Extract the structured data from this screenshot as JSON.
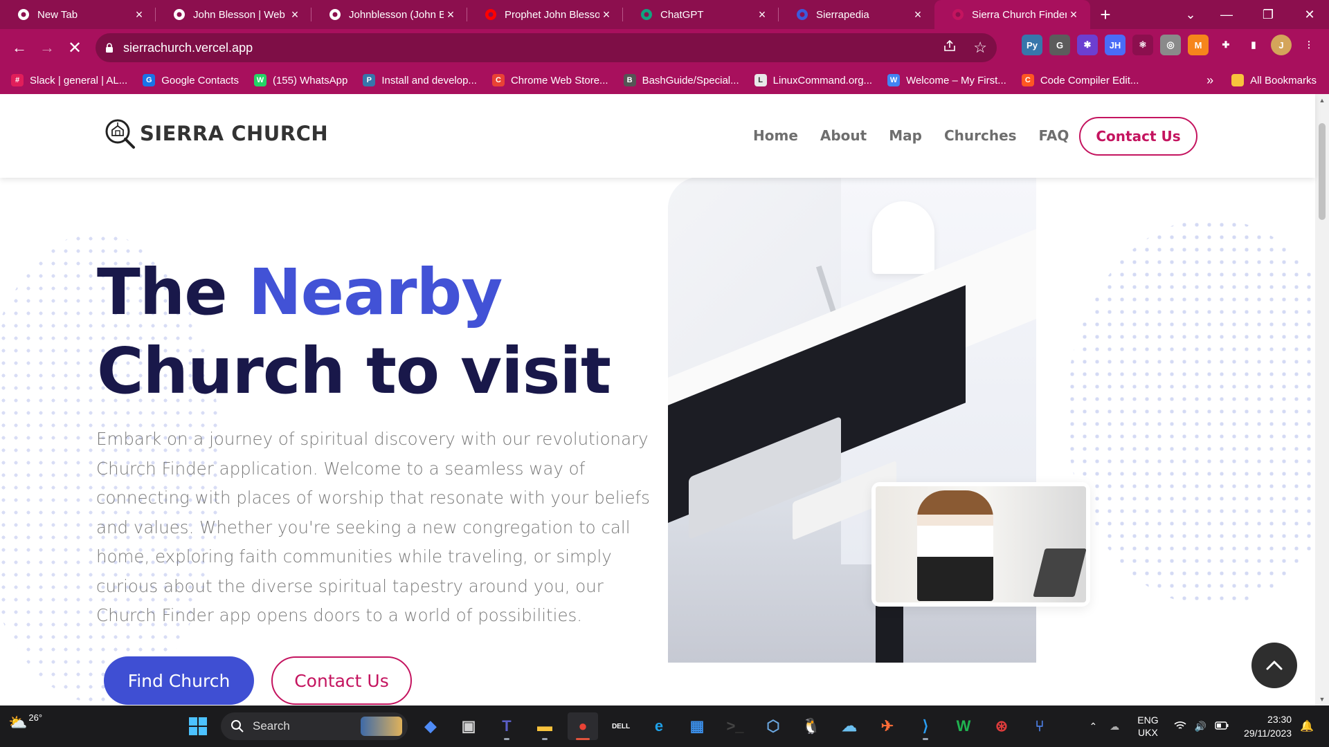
{
  "browser": {
    "tabs": [
      {
        "label": "New Tab",
        "icon": "chrome-icon",
        "color": "#ffffff"
      },
      {
        "label": "John Blesson | Web D",
        "icon": "globe-icon",
        "color": "#ffffff"
      },
      {
        "label": "Johnblesson (John Bl",
        "icon": "github-icon",
        "color": "#ffffff"
      },
      {
        "label": "Prophet John Blesson",
        "icon": "youtube-icon",
        "color": "#ff0000"
      },
      {
        "label": "ChatGPT",
        "icon": "chatgpt-icon",
        "color": "#10a37f"
      },
      {
        "label": "Sierrapedia",
        "icon": "sierrapedia-icon",
        "color": "#3b5bdb"
      },
      {
        "label": "Sierra Church Finder",
        "icon": "sierra-church-icon",
        "color": "#c4145f"
      }
    ],
    "active_tab_index": 6,
    "url": "sierrachurch.vercel.app",
    "bookmarks": [
      {
        "label": "Slack | general | AL...",
        "color": "#e01e5a",
        "glyph": "#"
      },
      {
        "label": "Google Contacts",
        "color": "#1a73e8",
        "glyph": "G"
      },
      {
        "label": "(155) WhatsApp",
        "color": "#25d366",
        "glyph": "W"
      },
      {
        "label": "Install and develop...",
        "color": "#3776ab",
        "glyph": "P"
      },
      {
        "label": "Chrome Web Store...",
        "color": "#e94235",
        "glyph": "C"
      },
      {
        "label": "BashGuide/Special...",
        "color": "#555555",
        "glyph": "B"
      },
      {
        "label": "LinuxCommand.org...",
        "color": "#e8e8e8",
        "glyph": "L"
      },
      {
        "label": "Welcome – My First...",
        "color": "#4285f4",
        "glyph": "W"
      },
      {
        "label": "Code Compiler Edit...",
        "color": "#ff5722",
        "glyph": "C"
      }
    ],
    "bookmarks_overflow": "»",
    "all_bookmarks": "All Bookmarks",
    "extensions": [
      {
        "name": "python-extension-icon",
        "color": "#3776ab",
        "glyph": "Py"
      },
      {
        "name": "grammarly-extension-icon",
        "color": "#5c5c5c",
        "glyph": "G"
      },
      {
        "name": "settings-extension-icon",
        "color": "#6c3fd1",
        "glyph": "✱"
      },
      {
        "name": "jh-extension-icon",
        "color": "#4a6cf7",
        "glyph": "JH"
      },
      {
        "name": "react-devtools-icon",
        "color": "#8c0f4e",
        "glyph": "⚛"
      },
      {
        "name": "web-extension-icon",
        "color": "#8a8a8a",
        "glyph": "◎"
      },
      {
        "name": "metamask-icon",
        "color": "#f6851b",
        "glyph": "M"
      },
      {
        "name": "extensions-puzzle-icon",
        "color": "#a8105d",
        "glyph": "✚"
      },
      {
        "name": "side-panel-icon",
        "color": "#a8105d",
        "glyph": "▮"
      },
      {
        "name": "profile-avatar-icon",
        "color": "#d4a55a",
        "glyph": "J"
      },
      {
        "name": "menu-kebab-icon",
        "color": "#a8105d",
        "glyph": "⋮"
      }
    ]
  },
  "site": {
    "brand": "SIERRA CHURCH",
    "nav": [
      "Home",
      "About",
      "Map",
      "Churches",
      "FAQ"
    ],
    "nav_cta": "Contact Us",
    "hero_title_1": "The ",
    "hero_title_accent": "Nearby",
    "hero_title_2": "Church to visit",
    "hero_text": "Embark on a journey of spiritual discovery with our revolutionary Church Finder application. Welcome to a seamless way of connecting with places of worship that resonate with your beliefs and values. Whether you're seeking a new congregation to call home, exploring faith communities while traveling, or simply curious about the diverse spiritual tapestry around you, our Church Finder app opens doors to a world of possibilities.",
    "btn_find": "Find Church",
    "btn_contact": "Contact Us",
    "colors": {
      "accent": "#4252d6",
      "brand": "#c4145f",
      "title": "#19184a"
    }
  },
  "taskbar": {
    "weather_temp": "26°",
    "search_placeholder": "Search",
    "lang_line1": "ENG",
    "lang_line2": "UKX",
    "time": "23:30",
    "date": "29/11/2023",
    "apps": [
      {
        "name": "copilot-app-icon",
        "color": "#4f8cf7",
        "glyph": "◆"
      },
      {
        "name": "task-view-icon",
        "color": "#d0d0d0",
        "glyph": "▣"
      },
      {
        "name": "teams-app-icon",
        "color": "#5b5fc7",
        "glyph": "T"
      },
      {
        "name": "file-explorer-icon",
        "color": "#f8c33c",
        "glyph": "▬"
      },
      {
        "name": "chrome-app-icon",
        "color": "#e94235",
        "glyph": "●"
      },
      {
        "name": "dell-app-icon",
        "color": "#ffffff",
        "glyph": "DELL"
      },
      {
        "name": "edge-app-icon",
        "color": "#1fa1e8",
        "glyph": "e"
      },
      {
        "name": "store-app-icon",
        "color": "#3b8ee8",
        "glyph": "▦"
      },
      {
        "name": "terminal-app-icon",
        "color": "#444444",
        "glyph": ">_"
      },
      {
        "name": "virtualbox-app-icon",
        "color": "#6aa6de",
        "glyph": "⬡"
      },
      {
        "name": "linux-app-icon",
        "color": "#f5c400",
        "glyph": "🐧"
      },
      {
        "name": "azure-app-icon",
        "color": "#6cc0f0",
        "glyph": "☁"
      },
      {
        "name": "postman-app-icon",
        "color": "#ff6c37",
        "glyph": "✈"
      },
      {
        "name": "vscode-app-icon",
        "color": "#2a9cf0",
        "glyph": "⟩"
      },
      {
        "name": "webstorm-app-icon",
        "color": "#20b350",
        "glyph": "W"
      },
      {
        "name": "help-app-icon",
        "color": "#e03c3c",
        "glyph": "⊛"
      },
      {
        "name": "sourcetree-app-icon",
        "color": "#4c7de0",
        "glyph": "⑂"
      }
    ]
  }
}
